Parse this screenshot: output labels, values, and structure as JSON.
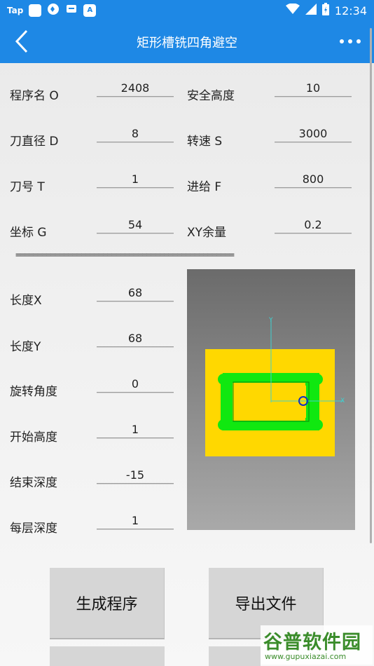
{
  "status_bar": {
    "left_icons": [
      "tap-icon",
      "square-app-icon",
      "shield-icon",
      "message-icon",
      "a-icon"
    ],
    "tap_label": "Tap",
    "a_label": "A",
    "time": "12:34"
  },
  "app_bar": {
    "title": "矩形槽铣四角避空"
  },
  "params_top": [
    {
      "label": "程序名 O",
      "value": "2408"
    },
    {
      "label": "安全高度",
      "value": "10"
    },
    {
      "label": "刀直径 D",
      "value": "8"
    },
    {
      "label": "转速 S",
      "value": "3000"
    },
    {
      "label": "刀号 T",
      "value": "1"
    },
    {
      "label": "进给 F",
      "value": "800"
    },
    {
      "label": "坐标 G",
      "value": "54"
    },
    {
      "label": "XY余量",
      "value": "0.2"
    }
  ],
  "divider": "==================================================",
  "params_bottom": [
    {
      "label": "长度X",
      "value": "68"
    },
    {
      "label": "长度Y",
      "value": "68"
    },
    {
      "label": "旋转角度",
      "value": "0"
    },
    {
      "label": "开始高度",
      "value": "1"
    },
    {
      "label": "结束深度",
      "value": "-15"
    },
    {
      "label": "每层深度",
      "value": "1"
    }
  ],
  "preview": {
    "axis_y": "Y",
    "axis_x": "X",
    "colors": {
      "stock": "#ffd800",
      "toolpath": "#10e810",
      "axis": "#3fd0d0",
      "bg_top": "#6b6b6b",
      "bg_bottom": "#a9a9a9"
    }
  },
  "buttons": {
    "generate": "生成程序",
    "export": "导出文件"
  },
  "watermark": {
    "main": "谷普软件园",
    "sub": "www.gupuxiazai.com"
  },
  "accent_color": "#1e88e5"
}
